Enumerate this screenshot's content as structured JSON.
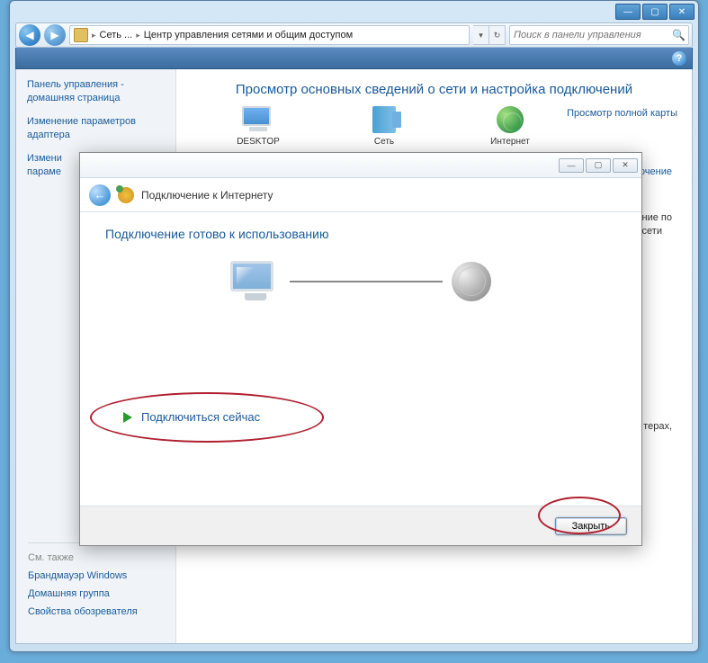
{
  "titlebar": {
    "minimize": "—",
    "maximize": "▢",
    "close": "✕"
  },
  "breadcrumb": {
    "part1": "Сеть ...",
    "part2": "Центр управления сетями и общим доступом"
  },
  "search": {
    "placeholder": "Поиск в панели управления"
  },
  "sidebar": {
    "home": "Панель управления - домашняя страница",
    "link1": "Изменение параметров адаптера",
    "link2_a": "Измени",
    "link2_b": "параме",
    "footer_header": "См. также",
    "footer1": "Брандмауэр Windows",
    "footer2": "Домашняя группа",
    "footer3": "Свойства обозревателя"
  },
  "main": {
    "title": "Просмотр основных сведений о сети и настройка подключений",
    "map_link": "Просмотр полной карты",
    "device1": "DESKTOP",
    "device2": "Сеть",
    "device3": "Интернет",
    "right_link": "ключение",
    "right_text1": "ние по",
    "right_text2": "сети",
    "right_text3": "терах,"
  },
  "dialog": {
    "titlebar": {
      "minimize": "—",
      "maximize": "▢",
      "close": "✕"
    },
    "title": "Подключение к Интернету",
    "heading": "Подключение готово к использованию",
    "connect_now": "Подключиться сейчас",
    "close_button": "Закрыть"
  }
}
